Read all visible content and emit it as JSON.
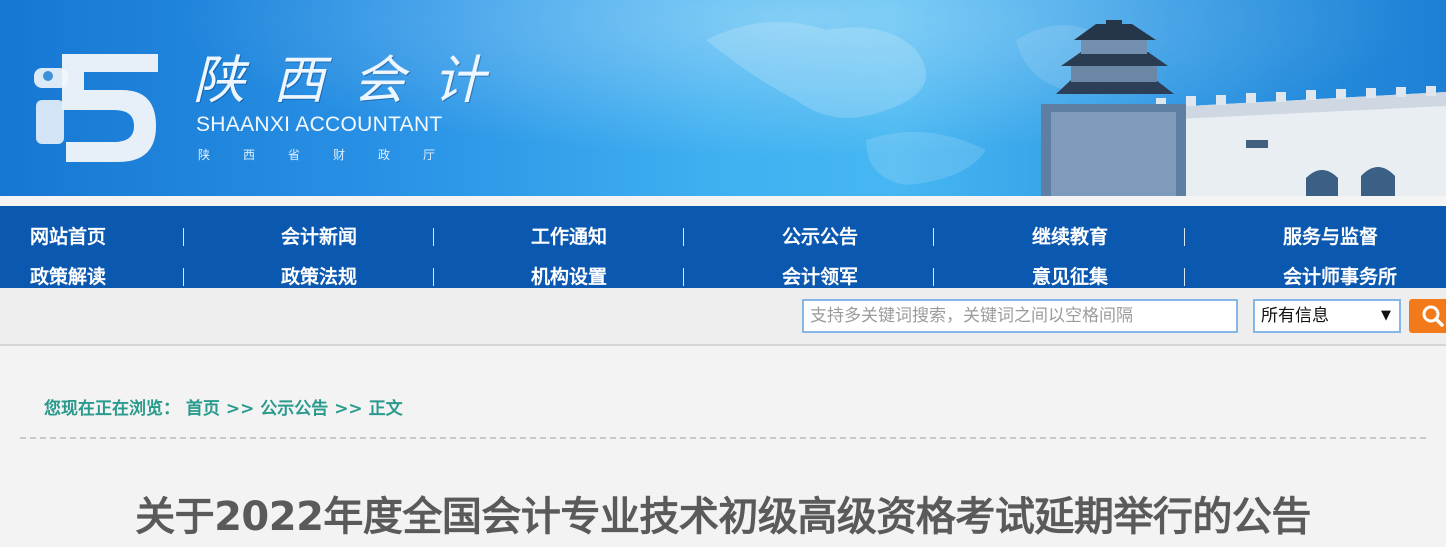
{
  "banner": {
    "logo_title": "陕西会计",
    "logo_en": "SHAANXI ACCOUNTANT",
    "logo_org": "陕西省财政厅"
  },
  "nav": {
    "row1": [
      "网站首页",
      "会计新闻",
      "工作通知",
      "公示公告",
      "继续教育",
      "服务与监督"
    ],
    "row2": [
      "政策解读",
      "政策法规",
      "机构设置",
      "会计领军",
      "意见征集",
      "会计师事务所"
    ]
  },
  "search": {
    "placeholder": "支持多关键词搜索，关键词之间以空格间隔",
    "selected": "所有信息",
    "button_icon": "search-icon"
  },
  "breadcrumb": {
    "lead": "您现在正在浏览：",
    "items": [
      "首页",
      "公示公告",
      "正文"
    ],
    "separator": ">>"
  },
  "article": {
    "title": "关于2022年度全国会计专业技术初级高级资格考试延期举行的公告"
  },
  "colors": {
    "nav_bg": "#0b58b0",
    "breadcrumb": "#2a9a8c",
    "search_button": "#f27a1a"
  }
}
